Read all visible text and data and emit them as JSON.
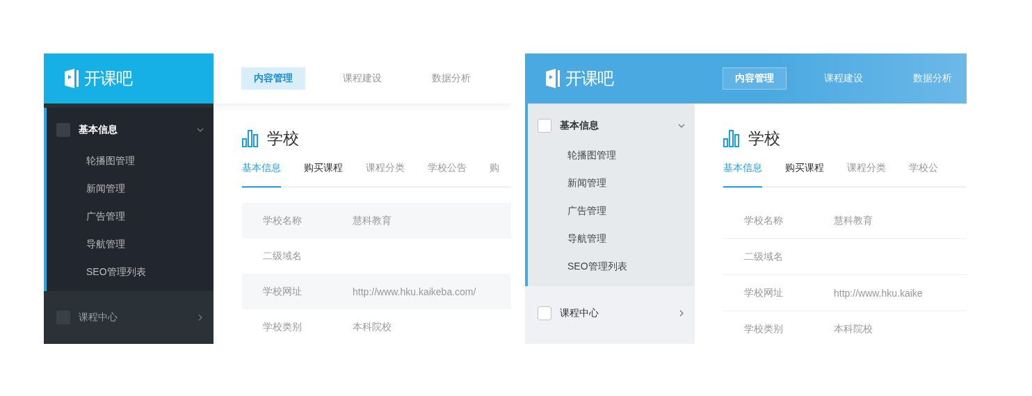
{
  "panels": [
    {
      "kind": "dark",
      "logo": "开课吧",
      "nav": [
        {
          "label": "内容管理",
          "selected": true
        },
        {
          "label": "课程建设",
          "selected": false
        },
        {
          "label": "数据分析",
          "selected": false
        }
      ],
      "sidebar": [
        {
          "label": "基本信息",
          "expanded": true,
          "items": [
            "轮播图管理",
            "新闻管理",
            "广告管理",
            "导航管理",
            "SEO管理列表"
          ]
        },
        {
          "label": "课程中心",
          "expanded": false
        }
      ],
      "page_title": "学校",
      "tabs": [
        {
          "label": "基本信息",
          "selected": true
        },
        {
          "label": "购买课程",
          "selected": false
        },
        {
          "label": "课程分类",
          "selected": false
        },
        {
          "label": "学校公告",
          "selected": false
        },
        {
          "label": "购",
          "selected": false
        }
      ],
      "fields": [
        {
          "label": "学校名称",
          "value": "慧科教育"
        },
        {
          "label": "二级域名"
        },
        {
          "label": "学校网址",
          "value": "http://www.hku.kaikeba.com/"
        },
        {
          "label": "学校类别",
          "value": "本科院校"
        }
      ]
    },
    {
      "kind": "light",
      "logo": "开课吧",
      "nav": [
        {
          "label": "内容管理",
          "selected": true
        },
        {
          "label": "课程建设",
          "selected": false
        },
        {
          "label": "数据分析",
          "selected": false
        }
      ],
      "sidebar": [
        {
          "label": "基本信息",
          "expanded": true,
          "items": [
            "轮播图管理",
            "新闻管理",
            "广告管理",
            "导航管理",
            "SEO管理列表"
          ]
        },
        {
          "label": "课程中心",
          "expanded": false
        }
      ],
      "page_title": "学校",
      "tabs": [
        {
          "label": "基本信息",
          "selected": true
        },
        {
          "label": "购买课程",
          "selected": false
        },
        {
          "label": "课程分类",
          "selected": false
        },
        {
          "label": "学校公",
          "selected": false
        }
      ],
      "fields": [
        {
          "label": "学校名称",
          "value": "慧科教育"
        },
        {
          "label": "二级域名"
        },
        {
          "label": "学校网址",
          "value": "http://www.hku.kaike"
        },
        {
          "label": "学校类别",
          "value": "本科院校"
        }
      ]
    }
  ]
}
